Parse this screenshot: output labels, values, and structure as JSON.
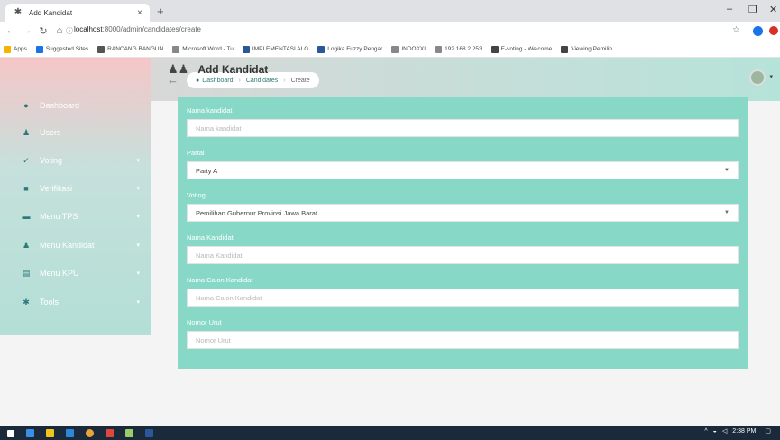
{
  "browser": {
    "tab_title": "Add Kandidat",
    "tab_close": "×",
    "new_tab": "+",
    "url_host": "localhost",
    "url_path": ":8000/admin/candidates/create",
    "window_min": "–",
    "window_max": "❐",
    "window_close": "✕",
    "bookmarks": [
      {
        "label": "Apps",
        "color": "#f4b400"
      },
      {
        "label": "Suggested Sites",
        "color": "#1a73e8"
      },
      {
        "label": "RANCANG BANGUN",
        "color": "#555555"
      },
      {
        "label": "Microsoft Word - Tu",
        "color": "#888888"
      },
      {
        "label": "IMPLEMENTASI ALG",
        "color": "#2b579a"
      },
      {
        "label": "Logika Fuzzy Pengar",
        "color": "#2b579a"
      },
      {
        "label": "INDOXXI",
        "color": "#888888"
      },
      {
        "label": "192.168.2.253",
        "color": "#888888"
      },
      {
        "label": "E-voting - Welcome",
        "color": "#444444"
      },
      {
        "label": "Viewing Pemilih",
        "color": "#444444"
      }
    ]
  },
  "sidebar": {
    "items": [
      {
        "label": "Dashboard",
        "icon": "dashboard-icon",
        "glyph": "●",
        "has_chevron": false
      },
      {
        "label": "Users",
        "icon": "user-icon",
        "glyph": "♟",
        "has_chevron": false
      },
      {
        "label": "Voting",
        "icon": "check-icon",
        "glyph": "✓",
        "has_chevron": true
      },
      {
        "label": "Verifikasi",
        "icon": "verify-icon",
        "glyph": "■",
        "has_chevron": true
      },
      {
        "label": "Menu TPS",
        "icon": "folder-icon",
        "glyph": "▬",
        "has_chevron": true
      },
      {
        "label": "Menu Kandidat",
        "icon": "users-icon",
        "glyph": "♟",
        "has_chevron": true
      },
      {
        "label": "Menu KPU",
        "icon": "building-icon",
        "glyph": "▤",
        "has_chevron": true
      },
      {
        "label": "Tools",
        "icon": "tools-icon",
        "glyph": "✱",
        "has_chevron": true
      }
    ]
  },
  "breadcrumb": {
    "items": [
      "Dashboard",
      "Candidates",
      "Create"
    ]
  },
  "page": {
    "title": "Add Kandidat"
  },
  "form": {
    "nama_kandidat": {
      "label": "Nama kandidat",
      "placeholder": "Nama kandidat"
    },
    "partai": {
      "label": "Partai",
      "value": "Party A"
    },
    "voting": {
      "label": "Voting",
      "value": "Pemilihan Gubernur Provinsi Jawa Barat"
    },
    "nama_kandidat2": {
      "label": "Nama Kandidat",
      "placeholder": "Nama Kandidat"
    },
    "nama_calon": {
      "label": "Nama Calon Kandidat",
      "placeholder": "Nama Calon Kandidat"
    },
    "nomor_urut": {
      "label": "Nomor Urut",
      "placeholder": "Nomor Urut"
    }
  },
  "taskbar": {
    "time": "2:38 PM"
  },
  "colors": {
    "accent": "#88d8c8",
    "sidebar_icon": "#2c7a7b"
  }
}
